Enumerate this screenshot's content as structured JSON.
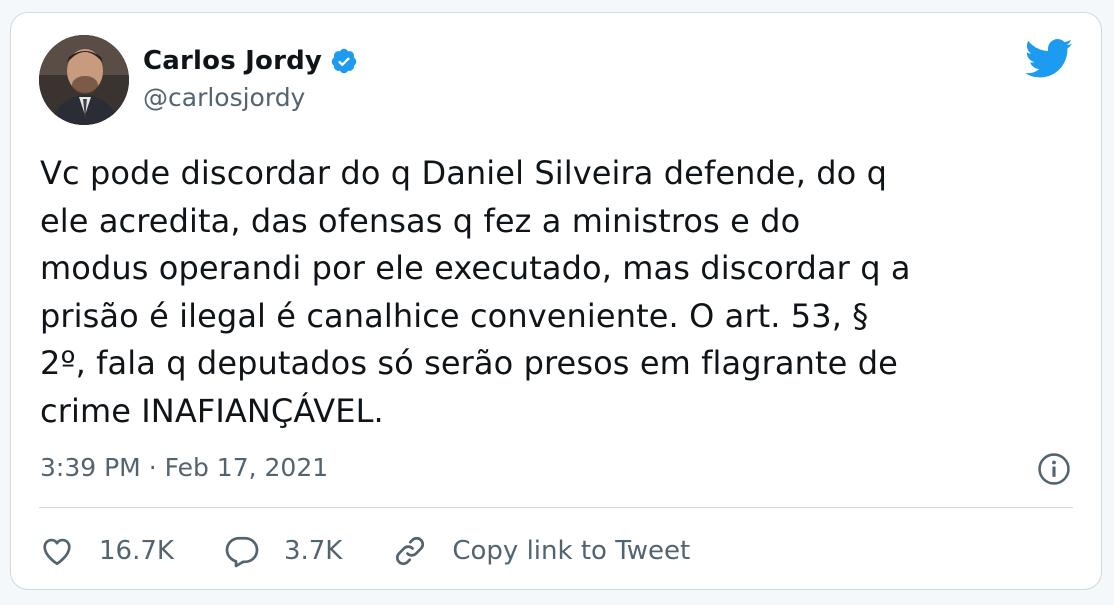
{
  "tweet": {
    "author": {
      "name": "Carlos Jordy",
      "handle": "@carlosjordy",
      "verified": true,
      "avatar": "profile-photo"
    },
    "text": "Vc pode discordar do q Daniel Silveira defende, do q\nele acredita, das ofensas q fez a ministros e do\nmodus operandi por ele executado, mas discordar q a\nprisão é ilegal é canalhice conveniente. O art. 53, §\n2º, fala q deputados só serão presos em flagrante de\ncrime INAFIANÇÁVEL.",
    "time": "3:39 PM",
    "separator": "·",
    "date": "Feb 17, 2021",
    "likes": "16.7K",
    "replies": "3.7K",
    "copy_link_label": "Copy link to Tweet"
  },
  "icons": {
    "brand": "twitter-bird-icon",
    "verified": "verified-badge-icon",
    "info": "info-icon",
    "like": "heart-icon",
    "reply": "speech-bubble-icon",
    "copy": "link-icon"
  },
  "colors": {
    "brand": "#1d9bf0",
    "text": "#0f1419",
    "secondary": "#536471",
    "border": "#cfd9de",
    "background": "#f5f8fa"
  }
}
